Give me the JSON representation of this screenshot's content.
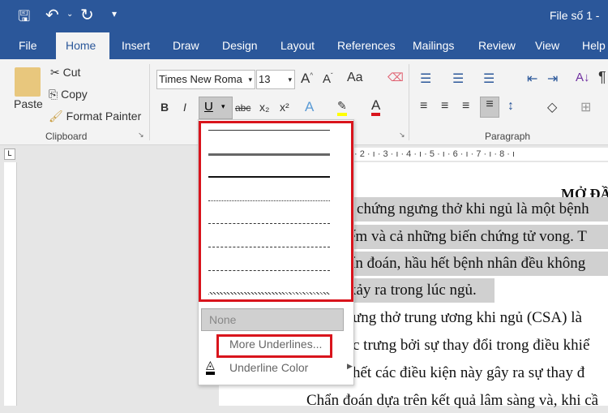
{
  "titlebar": {
    "title": "File số 1  -"
  },
  "tabs": [
    "File",
    "Home",
    "Insert",
    "Draw",
    "Design",
    "Layout",
    "References",
    "Mailings",
    "Review",
    "View",
    "Help"
  ],
  "clipboard": {
    "paste": "Paste",
    "cut": "Cut",
    "copy": "Copy",
    "format_painter": "Format Painter",
    "label": "Clipboard"
  },
  "font": {
    "name": "Times New Roma",
    "size": "13",
    "case": "Aa",
    "bold": "B",
    "italic": "I",
    "underline": "U",
    "strike": "abc",
    "sub": "x₂",
    "sup": "x²"
  },
  "paragraph": {
    "label": "Paragraph"
  },
  "ruler": "· 2 · ı · 3 · ı · 4 · ı · 5 · ı · 6 · ı · 7 · ı · 8 · ı",
  "underline_menu": {
    "none": "None",
    "more": "More Underlines...",
    "color": "Underline Color",
    "styles": [
      "single",
      "thick",
      "thicker",
      "dotted",
      "dashed",
      "dash-dot",
      "dash-dot-dot",
      "wavy"
    ]
  },
  "document": {
    "heading": "MỞ ĐẦ",
    "lines": [
      "i chứng ngưng thở khi ngủ là một bệnh",
      "ếm và cả những biến chứng tử vong. T",
      "ẩn đoán, hầu hết bệnh nhân đều không",
      "xảy ra trong lúc ngủ.",
      "ưng thở trung ương khi ngủ (CSA) là",
      "c trưng bởi sự thay đổi trong điều khiể",
      "hết các điều kiện này gây ra sự thay đ",
      "Chẩn đoán dựa trên kết quả lâm sàng và, khi cầ"
    ]
  },
  "colors": {
    "brand": "#2b579a",
    "highlight": "#ffff00",
    "font_color": "#d9141c",
    "callout": "#d9141c"
  }
}
